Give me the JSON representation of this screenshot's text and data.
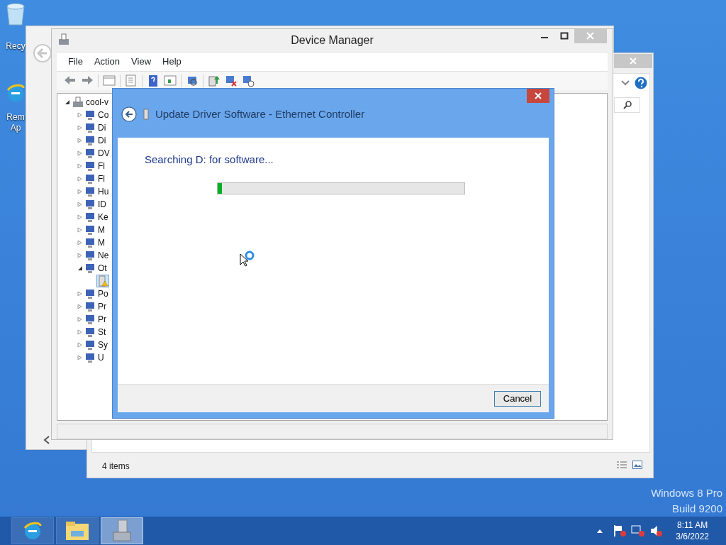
{
  "desktop": {
    "icons": [
      {
        "kind": "recycle_bin",
        "lines": [
          "Recy"
        ]
      },
      {
        "kind": "browser",
        "lines": [
          "Rem",
          "Ap"
        ]
      }
    ],
    "version": [
      "Windows 8 Pro",
      "Build 9200"
    ]
  },
  "back_window": {
    "status": "4 items"
  },
  "device_manager": {
    "title": "Device Manager",
    "menu": [
      "File",
      "Action",
      "View",
      "Help"
    ],
    "tree": {
      "label": "cool-v",
      "expanded": true,
      "selected": false,
      "children": [
        {
          "label": "Co",
          "expanded": false,
          "selected": false
        },
        {
          "label": "Di",
          "expanded": false,
          "selected": false
        },
        {
          "label": "Di",
          "expanded": false,
          "selected": false
        },
        {
          "label": "DV",
          "expanded": false,
          "selected": false
        },
        {
          "label": "Fl",
          "expanded": false,
          "selected": false
        },
        {
          "label": "Fl",
          "expanded": false,
          "selected": false
        },
        {
          "label": "Hu",
          "expanded": false,
          "selected": false
        },
        {
          "label": "ID",
          "expanded": false,
          "selected": false
        },
        {
          "label": "Ke",
          "expanded": false,
          "selected": false
        },
        {
          "label": "M",
          "expanded": false,
          "selected": false
        },
        {
          "label": "M",
          "expanded": false,
          "selected": false
        },
        {
          "label": "Ne",
          "expanded": false,
          "selected": false
        },
        {
          "label": "Ot",
          "expanded": true,
          "selected": false,
          "children": [
            {
              "warning": true,
              "selected": true
            }
          ]
        },
        {
          "label": "Po",
          "expanded": false,
          "selected": false
        },
        {
          "label": "Pr",
          "expanded": false,
          "selected": false
        },
        {
          "label": "Pr",
          "expanded": false,
          "selected": false
        },
        {
          "label": "St",
          "expanded": false,
          "selected": false
        },
        {
          "label": "Sy",
          "expanded": false,
          "selected": false
        },
        {
          "label": "U",
          "expanded": false,
          "selected": false
        }
      ]
    }
  },
  "dialog": {
    "title": "Update Driver Software - Ethernet Controller",
    "heading": "Searching D: for software...",
    "progress": {
      "level": 0.017
    },
    "buttons": [
      "Cancel"
    ]
  },
  "taskbar": {
    "apps": [
      {
        "kind": "browser",
        "selected": false
      },
      {
        "kind": "folder",
        "selected": false
      },
      {
        "kind": "device_manager",
        "selected": true
      }
    ],
    "tray": [
      {
        "kind": "flag"
      },
      {
        "kind": "network"
      },
      {
        "kind": "speaker"
      }
    ],
    "time": "8:11 AM",
    "date": "3/6/2022"
  }
}
